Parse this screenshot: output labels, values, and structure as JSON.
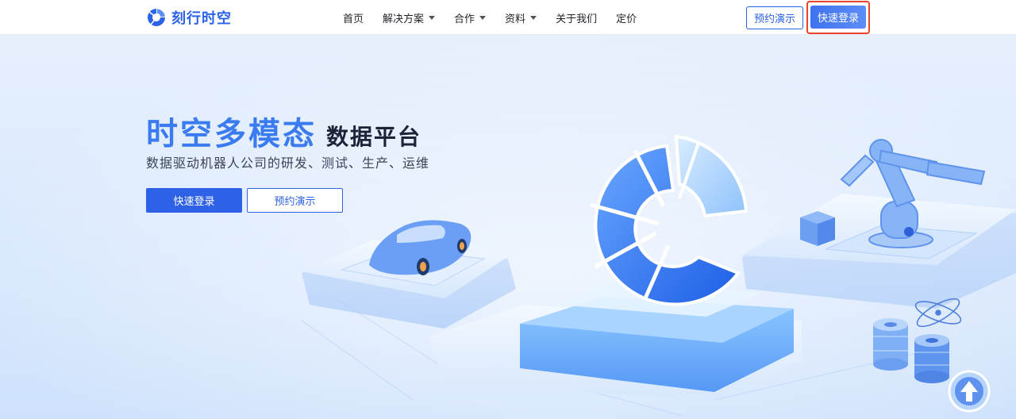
{
  "brand": {
    "name": "刻行时空",
    "logo_icon": "brand-c-logo-icon",
    "color": "#2b63e8"
  },
  "nav": {
    "items": [
      {
        "label": "首页",
        "has_dropdown": false
      },
      {
        "label": "解决方案",
        "has_dropdown": true
      },
      {
        "label": "合作",
        "has_dropdown": true
      },
      {
        "label": "资料",
        "has_dropdown": true
      },
      {
        "label": "关于我们",
        "has_dropdown": false
      },
      {
        "label": "定价",
        "has_dropdown": false
      }
    ],
    "demo_label": "预约演示",
    "login_label": "快速登录"
  },
  "hero": {
    "title_main": "时空多模态",
    "title_sub": "数据平台",
    "tagline": "数据驱动机器人公司的研发、测试、生产、运维",
    "primary_button": "快速登录",
    "secondary_button": "预约演示",
    "illustration": [
      "car-icon",
      "brand-c-logo-icon",
      "robot-arm-icon",
      "data-stack-icon",
      "upload-arrow-icon",
      "orbit-icon"
    ]
  },
  "colors": {
    "accent": "#2e62e6",
    "title_blue": "#3a7bf0",
    "highlight_border": "#e8442a"
  }
}
